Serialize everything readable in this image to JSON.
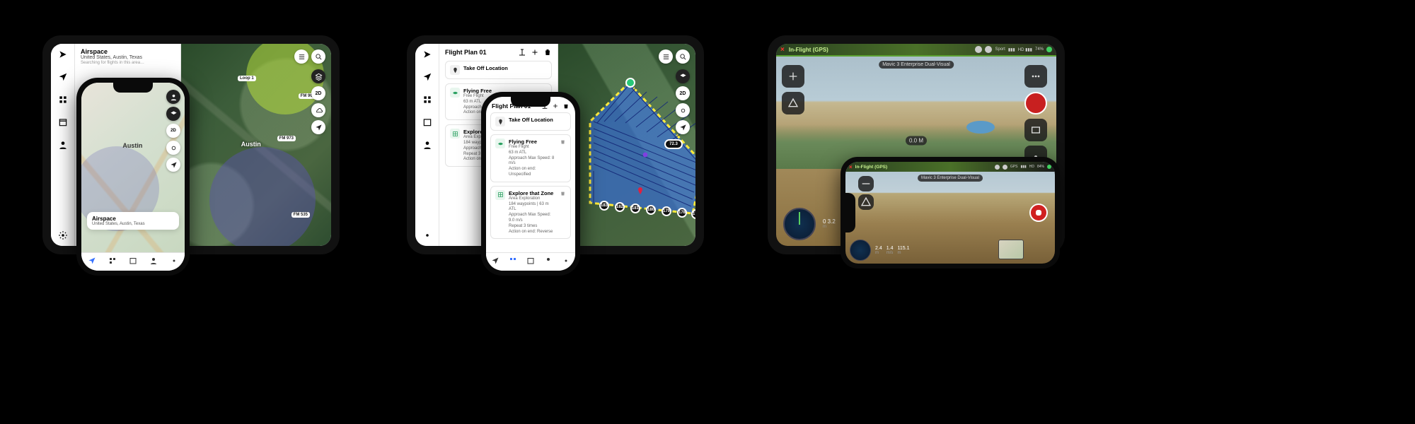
{
  "devices": {
    "tablet1": {
      "sidebar_icons": [
        "logo",
        "navigate",
        "mission",
        "calendar",
        "pilot",
        "settings"
      ],
      "panel": {
        "title": "Airspace",
        "subtitle": "United States, Austin, Texas",
        "hint": "Searching for flights in this area…"
      },
      "map": {
        "city_label": "Austin",
        "road_tags": [
          "FM 969",
          "Loop 1",
          "FM 973",
          "FM 535"
        ],
        "zones": [
          {
            "color": "green",
            "label": ""
          },
          {
            "color": "blue",
            "label": ""
          }
        ],
        "top_buttons": [
          "list",
          "search"
        ],
        "side_buttons": [
          "layers",
          "2d",
          "weather",
          "locate"
        ]
      }
    },
    "phone1": {
      "city_label": "Austin",
      "info": {
        "title": "Airspace",
        "subtitle": "United States, Austin, Texas"
      },
      "nav_icons": [
        "navigate",
        "mission",
        "calendar",
        "pilot",
        "settings"
      ],
      "top_buttons": [
        "user",
        "layers",
        "2d",
        "weather",
        "locate"
      ]
    },
    "tablet2": {
      "sidebar_icons": [
        "logo",
        "navigate",
        "mission",
        "calendar",
        "pilot",
        "settings"
      ],
      "panel": {
        "title": "Flight Plan 01",
        "header_icons": [
          "rename",
          "add",
          "delete"
        ],
        "takeoff_label": "Take Off Location",
        "missions": [
          {
            "icon": "bird",
            "title": "Flying Free",
            "sub1": "Free Flight",
            "sub2": "63 m ATL",
            "sub3": "Approach Max Speed: 8 m/s",
            "sub4": "Action on end: Unspecified"
          },
          {
            "icon": "grid",
            "title": "Explore that Zone",
            "sub1": "Area Exploration",
            "sub2": "184 waypoints | 63 m ATL",
            "sub3": "Approach Max Speed: 8 m/s",
            "sub4": "Repeat 3 times",
            "sub5": "Action on end: Unspecified"
          }
        ]
      },
      "map": {
        "area_fill": "#3772ff",
        "waypoint_count": 184,
        "altitude_pill": "72.3",
        "wp_labels": [
          "183",
          "182",
          "181",
          "180",
          "179",
          "178",
          "177"
        ],
        "top_buttons": [
          "list",
          "search"
        ],
        "side_buttons": [
          "layers",
          "2d",
          "weather",
          "locate"
        ]
      }
    },
    "phone2": {
      "header": {
        "title": "Flight Plan 01",
        "icons": [
          "rename",
          "add",
          "delete"
        ]
      },
      "takeoff_label": "Take Off Location",
      "missions": [
        {
          "icon": "bird",
          "title": "Flying Free",
          "sub1": "Free Flight",
          "sub2": "63 m ATL",
          "sub3": "Approach Max Speed: 8 m/s",
          "sub4": "Action on end: Unspecified"
        },
        {
          "icon": "grid",
          "title": "Explore that Zone",
          "sub1": "Area Exploration",
          "sub2": "184 waypoints | 63 m ATL",
          "sub3": "Approach Max Speed: 9.0 m/s",
          "sub4": "Repeat 3 times",
          "sub5": "Action on end: Reverse"
        }
      ],
      "nav_icons": [
        "navigate",
        "mission",
        "calendar",
        "pilot",
        "settings"
      ]
    },
    "tablet3": {
      "topbar": {
        "close": "×",
        "status": "In-Flight (GPS)",
        "indicators": [
          "Sport",
          "▮▮▮",
          "HD ▮▮▮",
          "74%"
        ]
      },
      "drone_label": "Mavic 3 Enterprise Dual-Visual",
      "distance_pill": "0.0 M",
      "left_icons": [
        "gimbal",
        "obstacle"
      ],
      "right_icons": [
        "menu",
        "record",
        "gallery",
        "settings"
      ],
      "telemetry": {
        "dist_value": "0 3.2",
        "dist_unit": "m",
        "alt_value": "0.0",
        "alt_unit": "m/s"
      }
    },
    "phone3": {
      "topbar": {
        "close": "×",
        "status": "In-Flight (GPS)",
        "indicators": [
          "GPS",
          "▮▮▮",
          "HD",
          "84%"
        ]
      },
      "drone_label": "Mavic 3 Enterprise Dual-Visual",
      "left_icons": [
        "gimbal",
        "obstacle"
      ],
      "telemetry": {
        "v1": "2.4",
        "u1": "m",
        "v2": "1.4",
        "u2": "m/s",
        "v3": "115.1",
        "u3": "m"
      }
    }
  }
}
